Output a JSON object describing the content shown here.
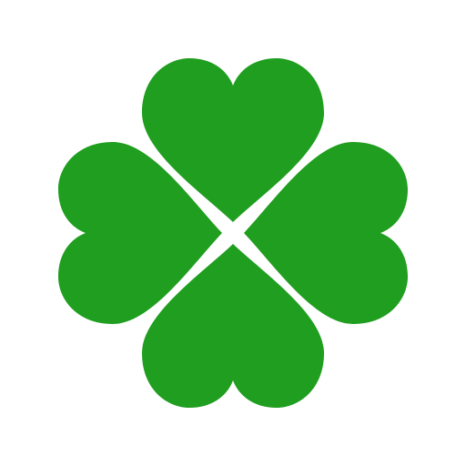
{
  "image": {
    "icon": "four-leaf-clover-icon",
    "leaf_color": "#1f9e1f",
    "background_color": "#ffffff",
    "leaves": [
      "top",
      "right",
      "bottom",
      "left"
    ]
  }
}
